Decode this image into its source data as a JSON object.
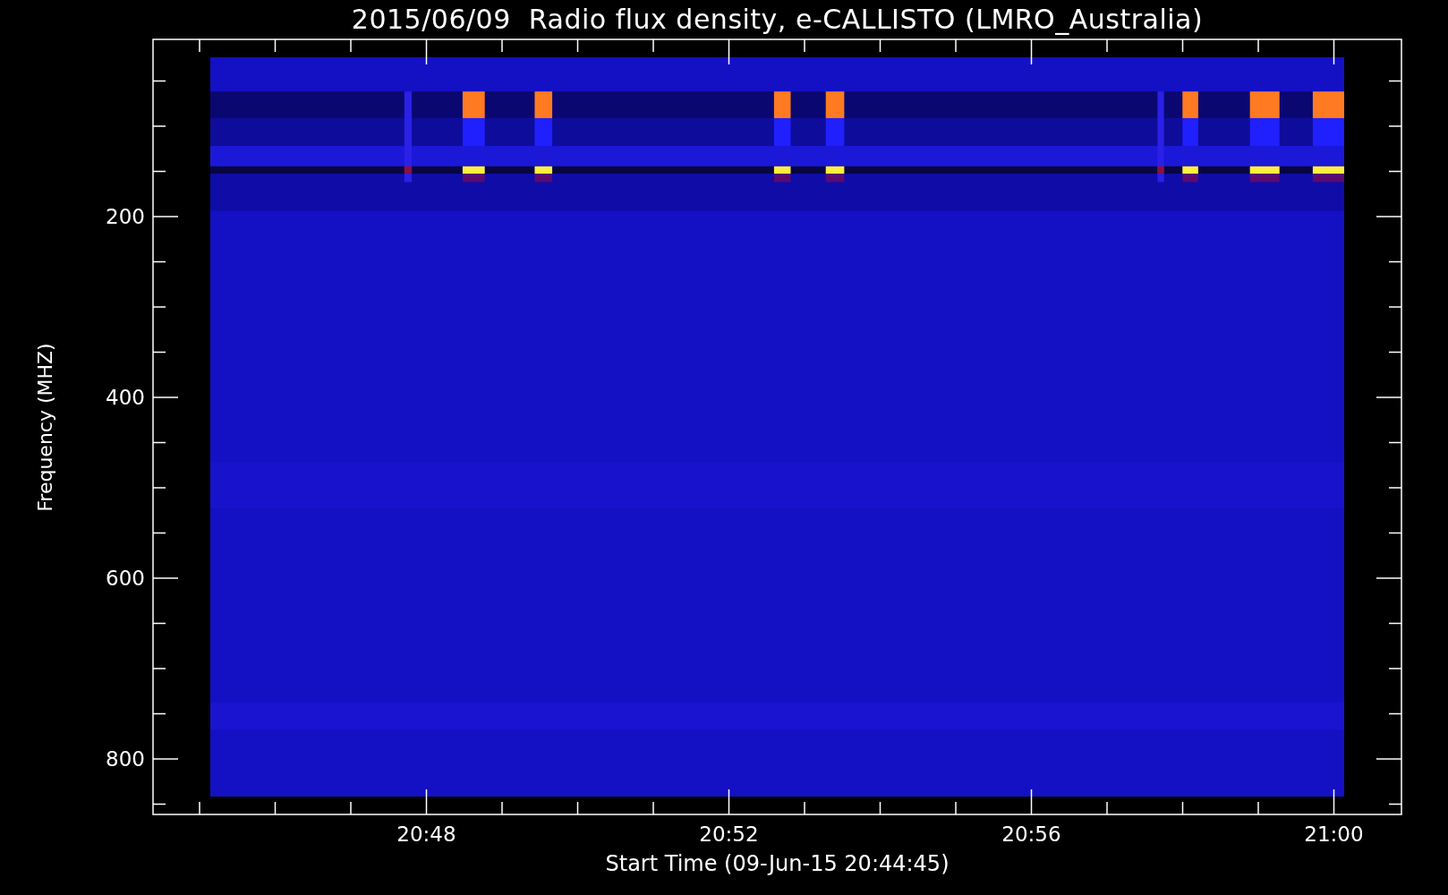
{
  "title": "2015/06/09  Radio flux density, e-CALLISTO (LMRO_Australia)",
  "y_axis": {
    "label": "Frequency (MHZ)",
    "ticks": [
      "200",
      "400",
      "600",
      "800"
    ]
  },
  "x_axis": {
    "label": "Start Time (09-Jun-15 20:44:45)",
    "ticks": [
      "20:48",
      "20:52",
      "20:56",
      "21:00"
    ]
  }
}
